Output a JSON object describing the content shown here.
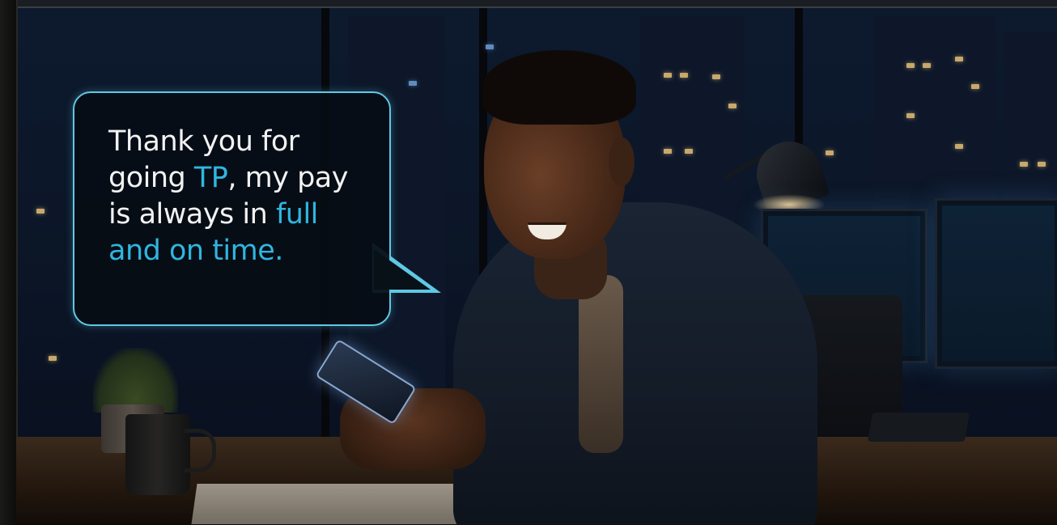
{
  "speech_bubble": {
    "line1": "Thank you for",
    "line2_pre": "going ",
    "line2_highlight": "TP",
    "line2_post": ", my pay",
    "line3_pre": "is always in ",
    "line3_highlight": "full",
    "line4_highlight": "and on time."
  },
  "colors": {
    "bubble_border": "#5fc8e4",
    "highlight": "#2fb6e0",
    "text": "#f2f2f2",
    "background": "#0a1120"
  }
}
